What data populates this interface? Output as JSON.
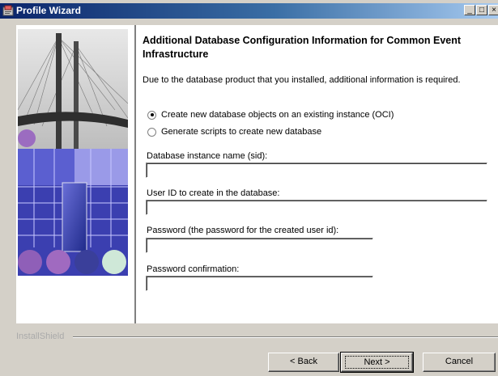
{
  "window": {
    "title": "Profile Wizard",
    "minimize_glyph": "_",
    "maximize_glyph": "□",
    "close_glyph": "×"
  },
  "page": {
    "heading": "Additional Database Configuration Information for Common Event Infrastructure",
    "intro": "Due to the database product that you installed, additional information is required."
  },
  "options": [
    {
      "label": "Create new database objects on an existing instance (OCI)",
      "selected": true
    },
    {
      "label": "Generate scripts to create new database",
      "selected": false
    }
  ],
  "fields": {
    "sid_label": "Database instance name (sid):",
    "sid_value": "",
    "userid_label": "User ID to create in the database:",
    "userid_value": "",
    "password_label": "Password (the password for the created user id):",
    "password_value": "",
    "confirm_label": "Password confirmation:",
    "confirm_value": ""
  },
  "footer": {
    "brand": "InstallShield",
    "back_label": "< Back",
    "next_label": "Next >",
    "cancel_label": "Cancel"
  },
  "colors": {
    "titlebar_start": "#0a246a",
    "titlebar_end": "#a6caf0",
    "dialog_bg": "#d4d0c8"
  }
}
